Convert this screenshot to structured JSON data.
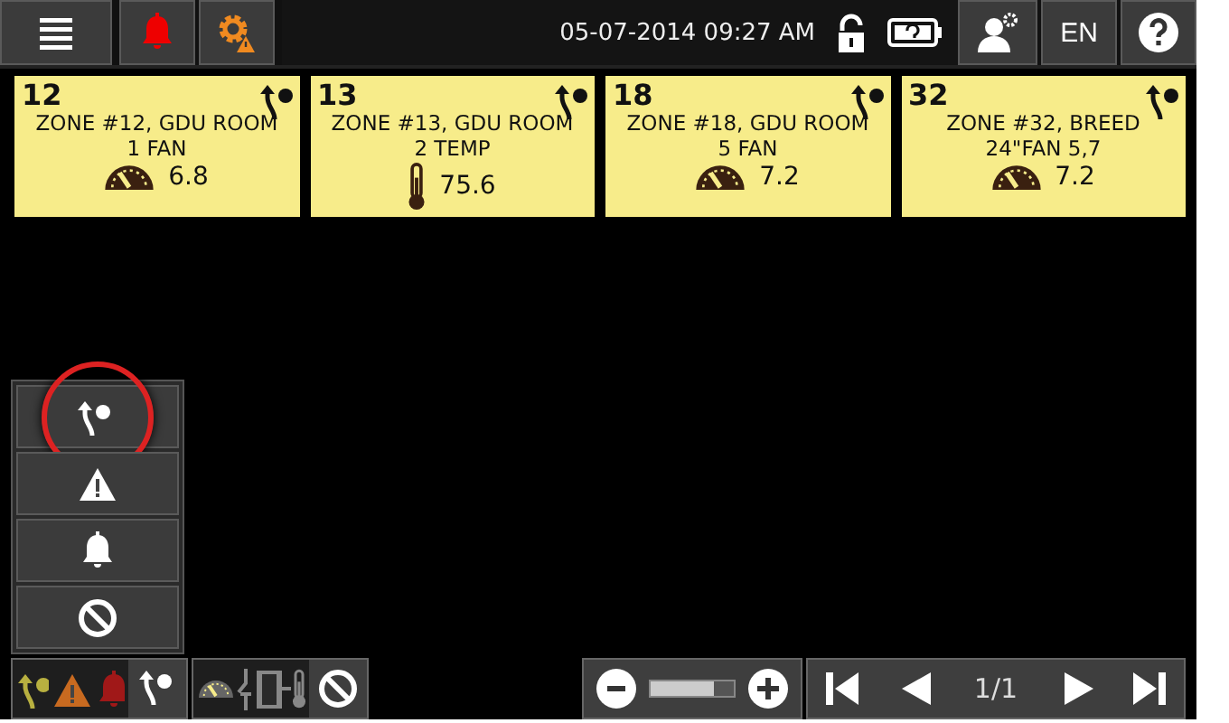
{
  "top_bar": {
    "date_time": "05-07-2014 09:27 AM",
    "language": "EN"
  },
  "tiles": [
    {
      "number": "12",
      "name": "ZONE #12, GDU ROOM",
      "detail": "1 FAN",
      "kind": "fan",
      "reading": "6.8"
    },
    {
      "number": "13",
      "name": "ZONE #13, GDU ROOM",
      "detail": "2 TEMP",
      "kind": "temp",
      "reading": "75.6"
    },
    {
      "number": "18",
      "name": "ZONE #18, GDU ROOM",
      "detail": "5 FAN",
      "kind": "fan",
      "reading": "7.2"
    },
    {
      "number": "32",
      "name": "ZONE #32, BREED",
      "detail": "24\"FAN 5,7",
      "kind": "fan",
      "reading": "7.2"
    }
  ],
  "side_panel": [
    {
      "kind": "route",
      "highlighted": true
    },
    {
      "kind": "warning",
      "highlighted": false
    },
    {
      "kind": "bell",
      "highlighted": false
    },
    {
      "kind": "block",
      "highlighted": false
    }
  ],
  "filters": [
    {
      "kind": "alert_types",
      "selected": false
    },
    {
      "kind": "route",
      "selected": true
    },
    {
      "kind": "devices",
      "selected": false
    },
    {
      "kind": "block",
      "selected": true
    }
  ],
  "zoom": {
    "level": 0.75
  },
  "pager": {
    "page": "1/1"
  }
}
